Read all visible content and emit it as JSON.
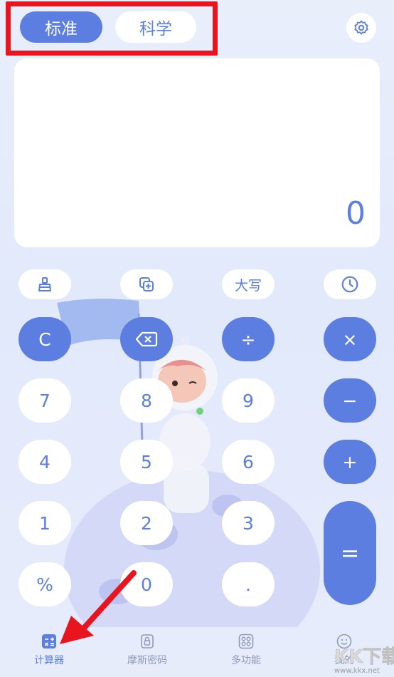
{
  "tabs": [
    {
      "label": "标准",
      "active": true
    },
    {
      "label": "科学",
      "active": false
    }
  ],
  "display": {
    "value": "0"
  },
  "function_row": [
    {
      "icon": "broom-icon"
    },
    {
      "icon": "copy-plus-icon"
    },
    {
      "label": "大写"
    },
    {
      "icon": "clock-icon"
    }
  ],
  "keys": {
    "clear": "C",
    "backspace_icon": "backspace-icon",
    "divide": "÷",
    "multiply": "×",
    "seven": "7",
    "eight": "8",
    "nine": "9",
    "minus": "−",
    "four": "4",
    "five": "5",
    "six": "6",
    "plus": "+",
    "one": "1",
    "two": "2",
    "three": "3",
    "equals": "=",
    "percent": "%",
    "zero": "0",
    "dot": "."
  },
  "nav": [
    {
      "label": "计算器",
      "icon": "calculator-icon",
      "active": true
    },
    {
      "label": "摩斯密码",
      "icon": "lock-icon",
      "active": false
    },
    {
      "label": "多功能",
      "icon": "grid-icon",
      "active": false
    },
    {
      "label": "我的",
      "icon": "smile-icon",
      "active": false
    }
  ],
  "watermark": {
    "text": "KK下载",
    "url": "www.kkx.net"
  },
  "colors": {
    "accent": "#5b7ee0",
    "highlight": "#e8151f",
    "background": "#e6ecfb"
  }
}
